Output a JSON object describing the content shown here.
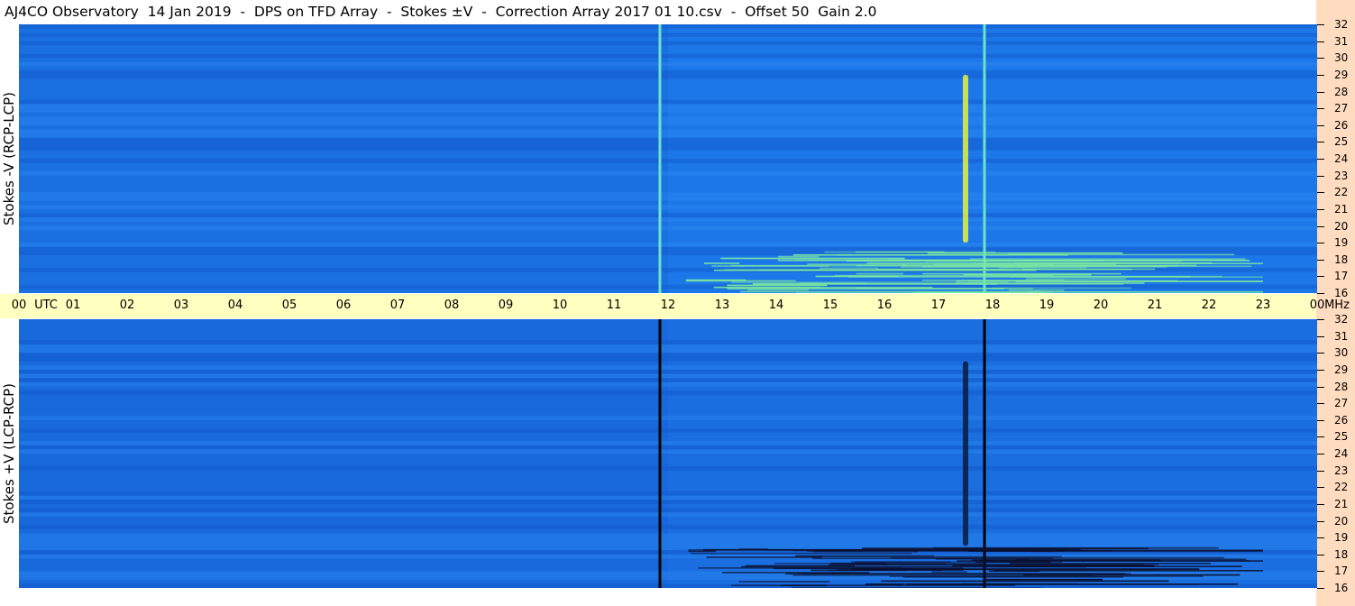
{
  "title": "AJ4CO Observatory  14 Jan 2019  -  DPS on TFD Array  -  Stokes ±V  -  Correction Array 2017 01 10.csv  -  Offset 50  Gain 2.0",
  "chart_data": {
    "type": "heatmap",
    "title": "AJ4CO Observatory  14 Jan 2019  -  DPS on TFD Array  -  Stokes ±V  -  Correction Array 2017 01 10.csv  -  Offset 50  Gain 2.0",
    "x_axis": {
      "ticks": [
        "00",
        "01",
        "02",
        "03",
        "04",
        "05",
        "06",
        "07",
        "08",
        "09",
        "10",
        "11",
        "12",
        "13",
        "14",
        "15",
        "16",
        "17",
        "18",
        "19",
        "20",
        "21",
        "22",
        "23",
        "00"
      ],
      "unit_label": "UTC",
      "range_hours": [
        0,
        24
      ]
    },
    "y_axis": {
      "ticks": [
        "32",
        "31",
        "30",
        "29",
        "28",
        "27",
        "26",
        "25",
        "24",
        "23",
        "22",
        "21",
        "20",
        "19",
        "18",
        "17",
        "16"
      ],
      "unit_label": "MHz",
      "range_mhz": [
        16,
        32
      ]
    },
    "panels": [
      {
        "ylabel": "Stokes -V (RCP-LCP)",
        "base_color": "#1c78e8",
        "features": [
          {
            "kind": "vertical_line",
            "t_utc": 11.85,
            "color": "#6ce2c8"
          },
          {
            "kind": "vertical_line",
            "t_utc": 17.85,
            "color": "#6ce2c8"
          },
          {
            "kind": "burst",
            "t_utc": 17.5,
            "mhz_from": 19.0,
            "mhz_to": 29.0,
            "color": "#e8f040"
          },
          {
            "kind": "interference_band",
            "t_from": 12.3,
            "t_to": 23.0,
            "mhz_from": 16.0,
            "mhz_to": 18.5,
            "color": "#7be8a0"
          }
        ]
      },
      {
        "ylabel": "Stokes +V (LCP-RCP)",
        "base_color": "#1a6ee0",
        "features": [
          {
            "kind": "vertical_line",
            "t_utc": 11.85,
            "color": "#000000"
          },
          {
            "kind": "vertical_line",
            "t_utc": 17.85,
            "color": "#000000"
          },
          {
            "kind": "burst",
            "t_utc": 17.5,
            "mhz_from": 18.5,
            "mhz_to": 29.5,
            "color": "#0a1a40"
          },
          {
            "kind": "interference_band",
            "t_from": 12.3,
            "t_to": 23.0,
            "mhz_from": 16.0,
            "mhz_to": 18.5,
            "color": "#0a1030"
          }
        ]
      }
    ],
    "colormap": [
      "#0b3fb0",
      "#1c78e8",
      "#3aa8f0",
      "#6ce2c8",
      "#e8f040",
      "#ff4030"
    ]
  }
}
